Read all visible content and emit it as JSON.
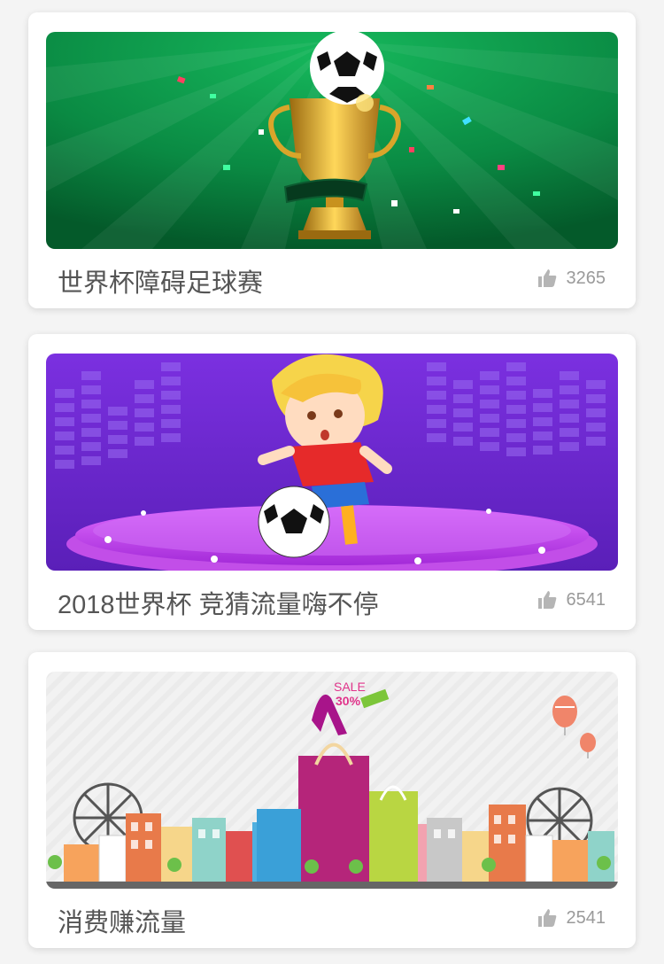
{
  "cards": [
    {
      "title": "世界杯障碍足球赛",
      "likes": "3265",
      "banner_icon": "trophy-soccer-banner",
      "accent": "#0a8a43"
    },
    {
      "title": "2018世界杯 竞猜流量嗨不停",
      "likes": "6541",
      "banner_icon": "kid-soccer-banner",
      "accent": "#7a2ed8"
    },
    {
      "title": "消费赚流量",
      "likes": "2541",
      "banner_icon": "shopping-city-banner",
      "accent": "#b5257a"
    }
  ],
  "icons": {
    "like": "thumbs-up-icon"
  },
  "banner_text": {
    "sale_tag": "SALE",
    "sale_percent": "30%"
  }
}
